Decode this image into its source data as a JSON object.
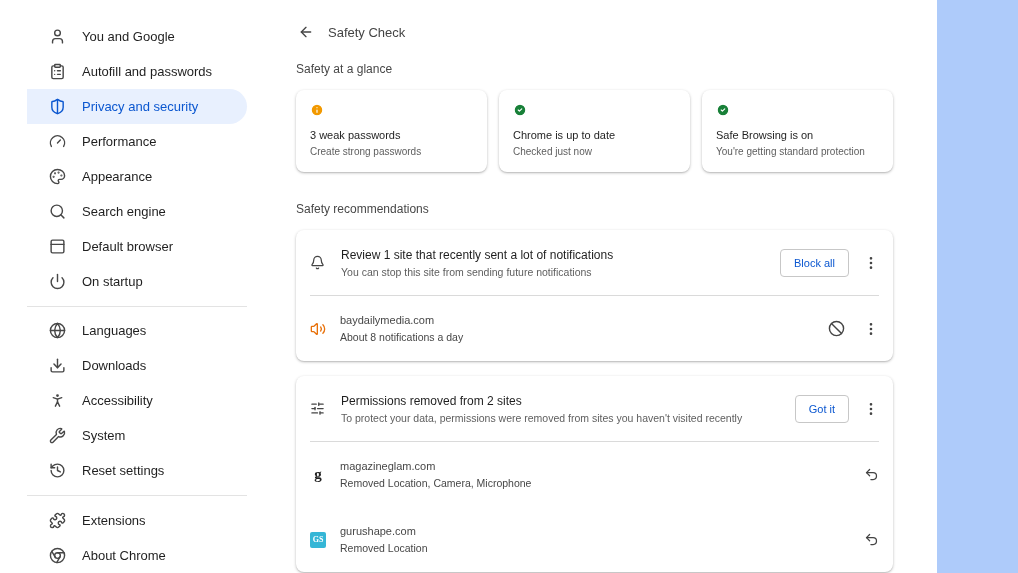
{
  "sidebar": {
    "groups": [
      {
        "items": [
          {
            "label": "You and Google",
            "selected": false
          },
          {
            "label": "Autofill and passwords",
            "selected": false
          },
          {
            "label": "Privacy and security",
            "selected": true
          },
          {
            "label": "Performance",
            "selected": false
          },
          {
            "label": "Appearance",
            "selected": false
          },
          {
            "label": "Search engine",
            "selected": false
          },
          {
            "label": "Default browser",
            "selected": false
          },
          {
            "label": "On startup",
            "selected": false
          }
        ]
      },
      {
        "items": [
          {
            "label": "Languages",
            "selected": false
          },
          {
            "label": "Downloads",
            "selected": false
          },
          {
            "label": "Accessibility",
            "selected": false
          },
          {
            "label": "System",
            "selected": false
          },
          {
            "label": "Reset settings",
            "selected": false
          }
        ]
      },
      {
        "items": [
          {
            "label": "Extensions",
            "selected": false
          },
          {
            "label": "About Chrome",
            "selected": false
          }
        ]
      }
    ]
  },
  "header": {
    "title": "Safety Check"
  },
  "glance": {
    "heading": "Safety at a glance",
    "cards": [
      {
        "kind": "warning",
        "title": "3 weak passwords",
        "subtitle": "Create strong passwords"
      },
      {
        "kind": "ok",
        "title": "Chrome is up to date",
        "subtitle": "Checked just now"
      },
      {
        "kind": "ok",
        "title": "Safe Browsing is on",
        "subtitle": "You're getting standard protection"
      }
    ]
  },
  "recommendations": {
    "heading": "Safety recommendations",
    "cards": [
      {
        "kind": "notifications",
        "title": "Review 1 site that recently sent a lot of notifications",
        "subtitle": "You can stop this site from sending future notifications",
        "button": "Block all",
        "sites": [
          {
            "kind": "block",
            "site": "baydailymedia.com",
            "detail": "About 8 notifications a day"
          }
        ]
      },
      {
        "kind": "permissions",
        "title": "Permissions removed from 2 sites",
        "subtitle": "To protect your data, permissions were removed from sites you haven't visited recently",
        "button": "Got it",
        "sites": [
          {
            "kind": "undo",
            "favicon": "g",
            "site": "magazineglam.com",
            "detail": "Removed Location, Camera, Microphone"
          },
          {
            "kind": "undo",
            "favicon": "GS",
            "site": "gurushape.com",
            "detail": "Removed Location"
          }
        ]
      }
    ]
  }
}
